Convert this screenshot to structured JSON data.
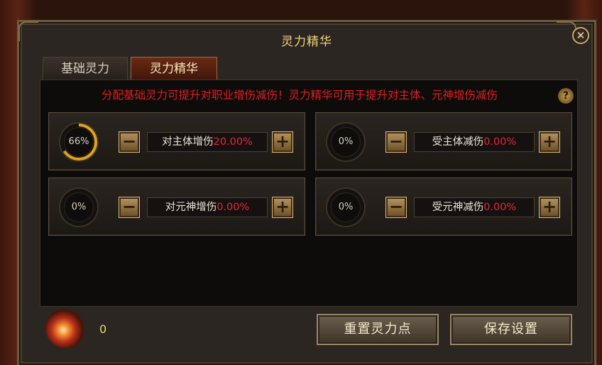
{
  "window": {
    "title": "灵力精华",
    "close_icon": "close-icon"
  },
  "tabs": [
    {
      "label": "基础灵力",
      "active": false
    },
    {
      "label": "灵力精华",
      "active": true
    }
  ],
  "notice": "分配基础灵力可提升对职业增伤减伤！灵力精华可用于提升对主体、元神增伤减伤",
  "help_icon": "question-icon",
  "stats": [
    {
      "progress_label": "66%",
      "progress": 0.66,
      "name": "对主体增伤",
      "value": "20.00%"
    },
    {
      "progress_label": "0%",
      "progress": 0,
      "name": "受主体减伤",
      "value": "0.00%"
    },
    {
      "progress_label": "0%",
      "progress": 0,
      "name": "对元神增伤",
      "value": "0.00%"
    },
    {
      "progress_label": "0%",
      "progress": 0,
      "name": "受元神减伤",
      "value": "0.00%"
    }
  ],
  "step": {
    "minus": "−",
    "plus": "+"
  },
  "footer": {
    "points": "0",
    "reset_label": "重置灵力点",
    "save_label": "保存设置"
  },
  "colors": {
    "accent_gold": "#f0d27a",
    "value_red": "#e8253a",
    "notice_red": "#e01e1e",
    "ring_gold": "#e0a020"
  }
}
